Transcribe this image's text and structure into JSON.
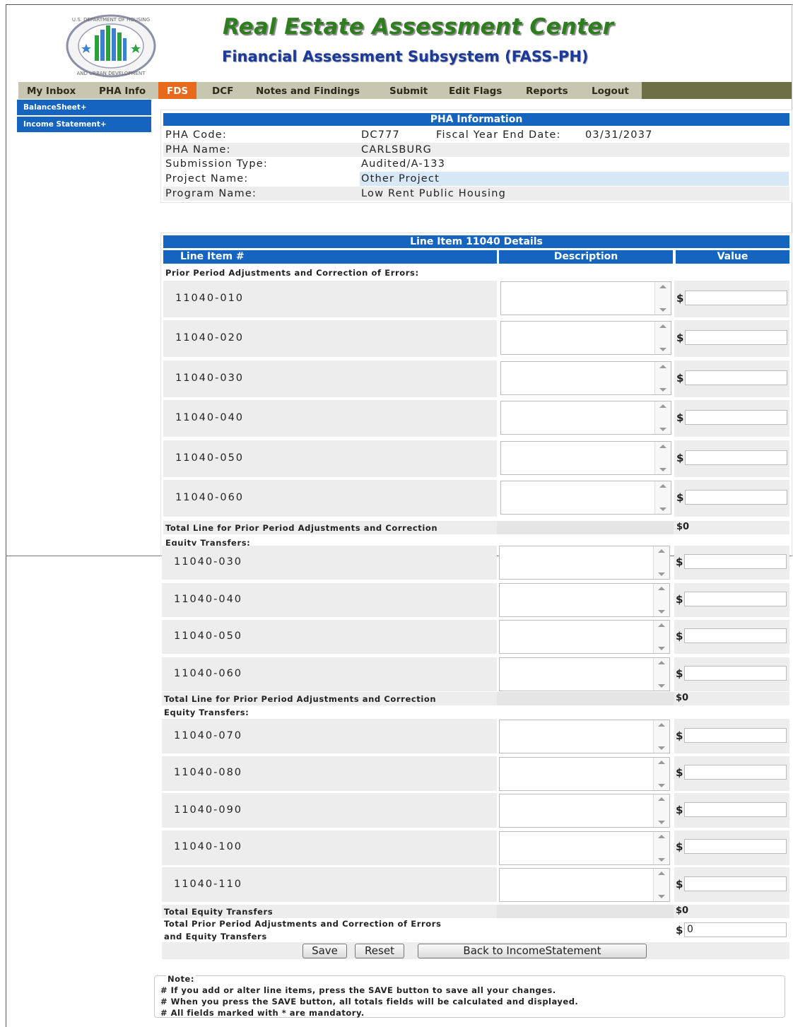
{
  "header": {
    "title": "Real Estate Assessment Center",
    "subtitle": "Financial Assessment Subsystem (FASS-PH)",
    "seal_top_text": "U.S. DEPARTMENT OF HOUSING",
    "seal_bottom_text": "AND URBAN DEVELOPMENT"
  },
  "nav": {
    "items": [
      "My Inbox",
      "PHA Info",
      "FDS",
      "DCF",
      "Notes and Findings",
      "Submit",
      "Edit Flags",
      "Reports",
      "Logout"
    ],
    "active": "FDS"
  },
  "sidebar": {
    "items": [
      "BalanceSheet+",
      "Income Statement+"
    ]
  },
  "pha": {
    "heading": "PHA Information",
    "code_label": "PHA Code:",
    "code_value": "DC777",
    "fye_label": "Fiscal Year End Date:",
    "fye_value": "03/31/2037",
    "name_label": "PHA Name:",
    "name_value": "CARLSBURG",
    "subtype_label": "Submission Type:",
    "subtype_value": "Audited/A-133",
    "project_label": "Project Name:",
    "project_value": "Other Project",
    "program_label": "Program Name:",
    "program_value": "Low Rent Public Housing"
  },
  "details": {
    "heading": "Line Item 11040 Details",
    "col_line": "Line Item #",
    "col_desc": "Description",
    "col_value": "Value",
    "currency": "$",
    "section_prior": "Prior Period Adjustments and Correction of Errors:",
    "total_prior": "Total Line for Prior Period Adjustments and Correction",
    "total_prior_value": "$0",
    "section_equity": "Equity Transfers:",
    "rows_a": [
      "11040-010",
      "11040-020",
      "11040-030",
      "11040-040",
      "11040-050",
      "11040-060"
    ],
    "rows_b": [
      "11040-030",
      "11040-040",
      "11040-050",
      "11040-060"
    ],
    "rows_c": [
      "11040-070",
      "11040-080",
      "11040-090",
      "11040-100",
      "11040-110"
    ],
    "total_equity": "Total Equity Transfers",
    "total_equity_value": "$0",
    "grand_total_line1": "Total Prior Period Adjustments and Correction of Errors",
    "grand_total_line2": "and Equity Transfers",
    "grand_total_value": "0"
  },
  "buttons": {
    "save": "Save",
    "reset": "Reset",
    "back": "Back to IncomeStatement"
  },
  "note": {
    "title": "Note:",
    "lines": [
      "# If you add or alter line items, press the SAVE button to save all your changes.",
      "# When you press the SAVE button, all totals fields will be calculated and displayed.",
      "# All fields marked with * are mandatory."
    ]
  },
  "colors": {
    "accent_blue": "#1565c0",
    "nav_active": "#e8681c",
    "title_green": "#2e7d1e",
    "title_blue": "#1b3a9a"
  }
}
